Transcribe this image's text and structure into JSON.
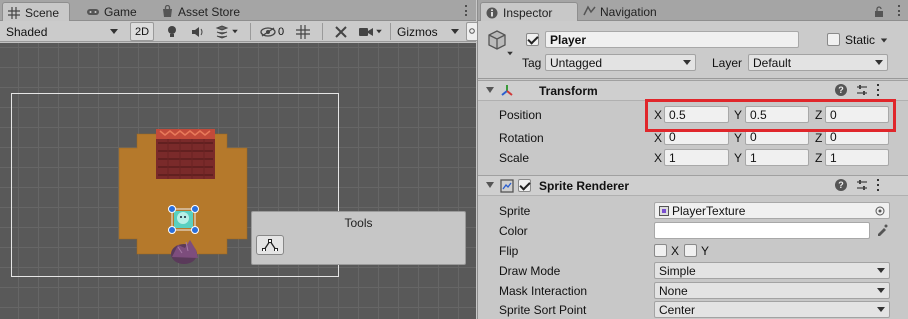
{
  "scene": {
    "tabs": [
      {
        "label": "Scene",
        "icon": "grid-icon",
        "active": true
      },
      {
        "label": "Game",
        "icon": "gamepad-icon",
        "active": false
      },
      {
        "label": "Asset Store",
        "icon": "store-icon",
        "active": false
      }
    ],
    "toolbar": {
      "shading_mode": "Shaded",
      "mode_2d": "2D",
      "hidden_count": "0",
      "gizmos": "Gizmos"
    },
    "tools_overlay": {
      "title": "Tools"
    }
  },
  "inspector": {
    "tabs": [
      {
        "label": "Inspector",
        "icon": "info-icon",
        "active": true
      },
      {
        "label": "Navigation",
        "icon": "navigation-icon",
        "active": false
      }
    ],
    "object": {
      "name": "Player",
      "active": true,
      "static_label": "Static",
      "tag_label": "Tag",
      "tag_value": "Untagged",
      "layer_label": "Layer",
      "layer_value": "Default"
    },
    "transform": {
      "title": "Transform",
      "rows": [
        {
          "label": "Position",
          "x": "0.5",
          "y": "0.5",
          "z": "0"
        },
        {
          "label": "Rotation",
          "x": "0",
          "y": "0",
          "z": "0"
        },
        {
          "label": "Scale",
          "x": "1",
          "y": "1",
          "z": "1"
        }
      ],
      "axis_labels": [
        "X",
        "Y",
        "Z"
      ]
    },
    "sprite_renderer": {
      "title": "Sprite Renderer",
      "enabled": true,
      "sprite_label": "Sprite",
      "sprite_value": "PlayerTexture",
      "color_label": "Color",
      "color_value": "#ffffff",
      "flip_label": "Flip",
      "flip_x": "X",
      "flip_y": "Y",
      "draw_mode_label": "Draw Mode",
      "draw_mode_value": "Simple",
      "mask_label": "Mask Interaction",
      "mask_value": "None",
      "sort_label": "Sprite Sort Point",
      "sort_value": "Center"
    }
  },
  "colors": {
    "highlight": "#e0262b",
    "sand": "#b5792b",
    "wall": "#7a2a2a"
  }
}
